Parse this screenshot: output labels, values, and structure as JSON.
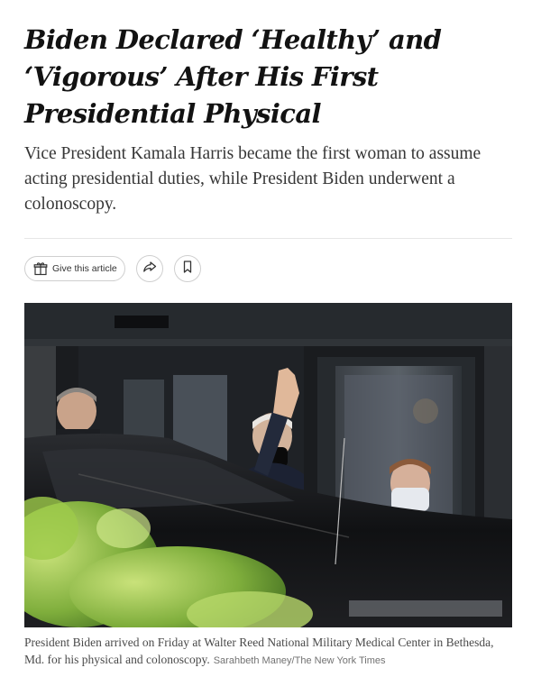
{
  "article": {
    "headline": "Biden Declared ‘Healthy’ and ‘Vigorous’ After His First Presidential Physical",
    "summary": "Vice President Kamala Harris became the first woman to assume acting presidential duties, while President Biden underwent a colonoscopy."
  },
  "toolbar": {
    "gift_label": "Give this article",
    "icons": [
      "gift-icon",
      "share-icon",
      "bookmark-icon"
    ]
  },
  "photo": {
    "caption": "President Biden arrived on Friday at Walter Reed National Military Medical Center in Bethesda, Md. for his physical and colonoscopy.",
    "credit": "Sarahbeth Maney/The New York Times"
  },
  "colors": {
    "text": "#121212",
    "summary": "#363636",
    "border": "#cfcfcf"
  }
}
